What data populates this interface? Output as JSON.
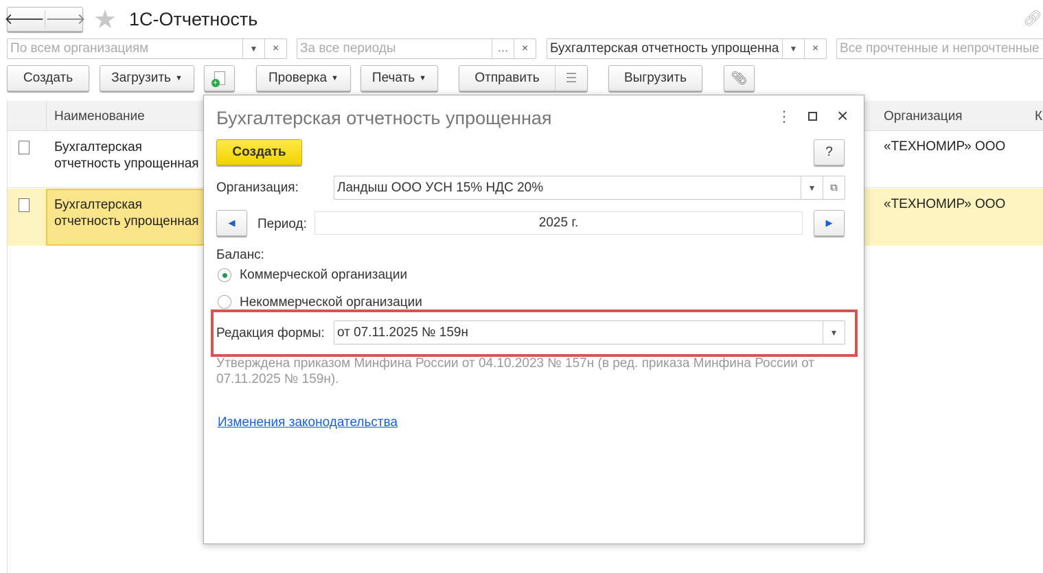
{
  "app": {
    "title": "1С-Отчетность"
  },
  "filters": {
    "organization_placeholder": "По всем организациям",
    "period_placeholder": "За все периоды",
    "report_type_value": "Бухгалтерская отчетность упрощенна",
    "read_status_placeholder": "Все прочтенные и непрочтенные"
  },
  "toolbar": {
    "create": "Создать",
    "load": "Загрузить",
    "check": "Проверка",
    "print": "Печать",
    "send": "Отправить",
    "export": "Выгрузить"
  },
  "table": {
    "columns": [
      "Наименование",
      "Организация",
      "К"
    ],
    "rows": [
      {
        "name": "Бухгалтерская отчетность упрощенная",
        "organization": "«ТЕХНОМИР» ООО",
        "selected": false
      },
      {
        "name": "Бухгалтерская отчетность упрощенная",
        "organization": "«ТЕХНОМИР» ООО",
        "selected": true
      }
    ]
  },
  "dialog": {
    "title": "Бухгалтерская отчетность упрощенная",
    "create_button": "Создать",
    "help_button": "?",
    "organization_label": "Организация:",
    "organization_value": "Ландыш ООО УСН 15% НДС 20%",
    "period_label": "Период:",
    "period_value": "2025 г.",
    "balance_label": "Баланс:",
    "balance_options": [
      {
        "label": "Коммерческой организации",
        "checked": true
      },
      {
        "label": "Некоммерческой организации",
        "checked": false
      }
    ],
    "form_edition_label": "Редакция формы:",
    "form_edition_value": "от 07.11.2025 № 159н",
    "approval_note": "Утверждена приказом Минфина России от 04.10.2023 № 157н (в ред. приказа Минфина России от 07.11.2025 № 159н).",
    "legislation_link": "Изменения законодательства"
  },
  "colors": {
    "accent_yellow": "#f5d800",
    "highlight": "#d9534f",
    "link": "#1a5fd0",
    "row_selected": "#fdf3bf"
  }
}
